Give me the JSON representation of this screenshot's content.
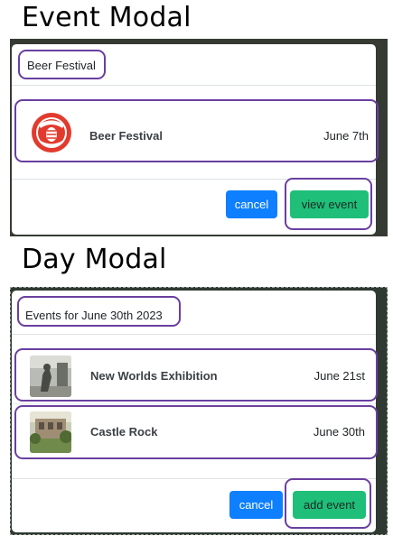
{
  "event_modal": {
    "section_title": "Event Modal",
    "header_title": "Beer Festival",
    "event": {
      "name": "Beer Festival",
      "date": "June 7th",
      "thumbnail_icon": "festival-hop-badge"
    },
    "buttons": {
      "cancel": "cancel",
      "primary": "view event"
    }
  },
  "day_modal": {
    "section_title": "Day Modal",
    "header_title": "Events for June 30th 2023",
    "events": [
      {
        "name": "New Worlds Exhibition",
        "date": "June 21st",
        "thumbnail_icon": "statue-photo"
      },
      {
        "name": "Castle Rock",
        "date": "June 30th",
        "thumbnail_icon": "building-photo"
      }
    ],
    "buttons": {
      "cancel": "cancel",
      "primary": "add event"
    }
  },
  "colors": {
    "highlight": "#6a3fa0",
    "cancel_button": "#0d7fff",
    "primary_button": "#1fbf7a",
    "badge_red": "#e23b2e"
  }
}
